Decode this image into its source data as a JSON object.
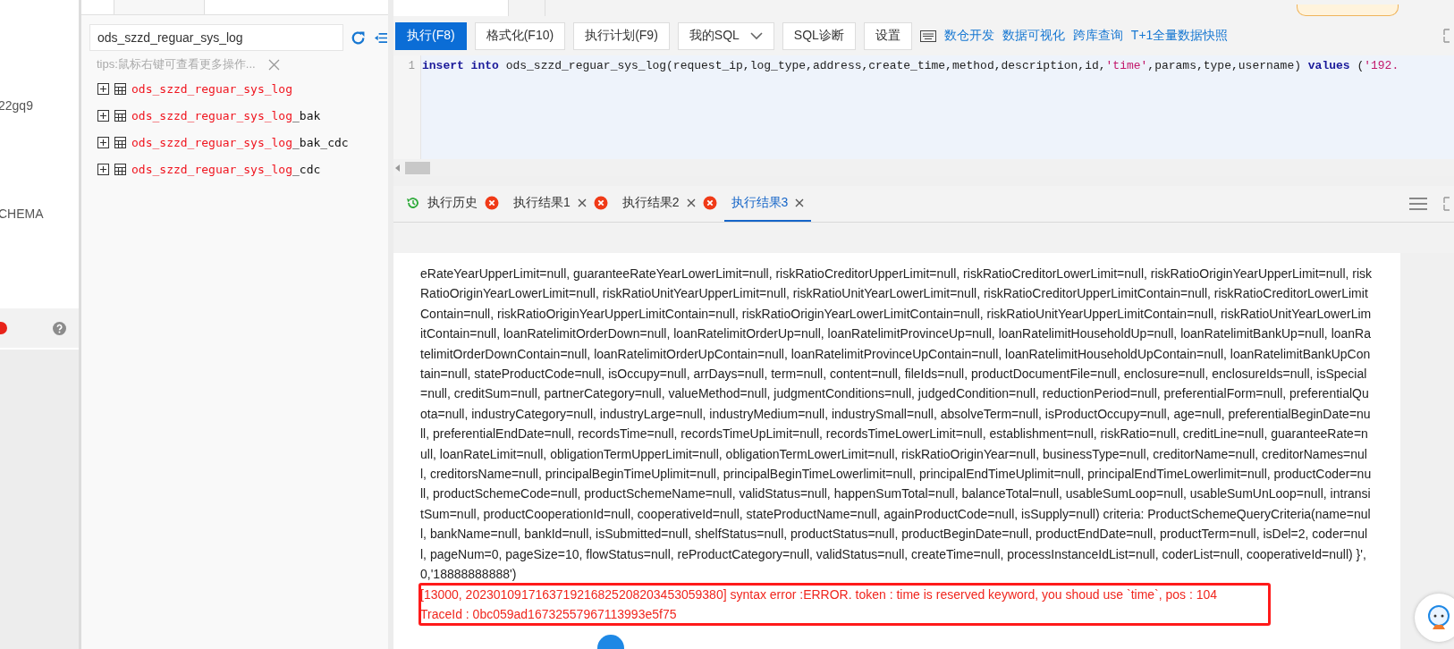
{
  "left_sidebar": {
    "items": [
      {
        "label": "22gq9"
      },
      {
        "label": "CHEMA"
      }
    ]
  },
  "object_panel": {
    "search": {
      "value": "ods_szzd_reguar_sys_log"
    },
    "tips": "tips:鼠标右键可查看更多操作...",
    "tree": [
      {
        "match": "ods_szzd_reguar_sys_log",
        "expanded": false
      },
      {
        "match": "ods_szzd_reguar_sys_log",
        "rest": "_bak",
        "expanded": false
      },
      {
        "match": "ods_szzd_reguar_sys_log",
        "rest": "_bak_cdc",
        "expanded": false
      },
      {
        "match": "ods_szzd_reguar_sys_log",
        "rest": "_cdc",
        "expanded": false
      }
    ]
  },
  "toolbar": {
    "buttons": [
      {
        "label": "执行(F8)",
        "kind": "primary"
      },
      {
        "label": "格式化(F10)",
        "kind": "default"
      },
      {
        "label": "执行计划(F9)",
        "kind": "default"
      },
      {
        "label": "我的SQL",
        "kind": "dropdown"
      },
      {
        "label": "SQL诊断",
        "kind": "default"
      },
      {
        "label": "设置",
        "kind": "default"
      }
    ],
    "links": [
      "数仓开发",
      "数据可视化",
      "跨库查询",
      "T+1全量数据快照"
    ]
  },
  "editor": {
    "line_number": "1",
    "tokens": [
      {
        "kind": "keyword",
        "text": "insert "
      },
      {
        "kind": "keyword",
        "text": "into"
      },
      {
        "kind": "plain",
        "text": " ods_szzd_reguar_sys_log(request_ip,log_type,address,create_time,method,description,id,"
      },
      {
        "kind": "string",
        "text": "'time'"
      },
      {
        "kind": "plain",
        "text": ",params,type,username) "
      },
      {
        "kind": "keyword",
        "text": "values"
      },
      {
        "kind": "plain",
        "text": " ("
      },
      {
        "kind": "string",
        "text": "'192."
      }
    ]
  },
  "result_tabs": [
    {
      "label": "执行历史",
      "kind": "history",
      "selected": false
    },
    {
      "label": "执行结果1",
      "kind": "result",
      "selected": false
    },
    {
      "label": "执行结果2",
      "kind": "result",
      "selected": false
    },
    {
      "label": "执行结果3",
      "kind": "result",
      "selected": true
    }
  ],
  "result": {
    "lines": [
      "eRateYearUpperLimit=null, guaranteeRateYearLowerLimit=null, riskRatioCreditorUpperLimit=null, riskRatioCreditorLowerLimit=null, riskRatioOriginYearUpperLimit=null, risk",
      "RatioOriginYearLowerLimit=null, riskRatioUnitYearUpperLimit=null, riskRatioUnitYearLowerLimit=null, riskRatioCreditorUpperLimitContain=null, riskRatioCreditorLowerLimit",
      "Contain=null, riskRatioOriginYearUpperLimitContain=null, riskRatioOriginYearLowerLimitContain=null, riskRatioUnitYearUpperLimitContain=null, riskRatioUnitYearLowerLim",
      "itContain=null, loanRatelimitOrderDown=null, loanRatelimitOrderUp=null, loanRatelimitProvinceUp=null, loanRatelimitHouseholdUp=null, loanRatelimitBankUp=null, loanRa",
      "telimitOrderDownContain=null, loanRatelimitOrderUpContain=null, loanRatelimitProvinceUpContain=null, loanRatelimitHouseholdUpContain=null, loanRatelimitBankUpCon",
      "tain=null, stateProductCode=null, isOccupy=null, arrDays=null, term=null, content=null, fileIds=null, productDocumentFile=null, enclosure=null, enclosureIds=null, isSpecial",
      "=null, creditSum=null, partnerCategory=null, valueMethod=null, judgmentConditions=null, judgedCondition=null, reductionPeriod=null, preferentialForm=null, preferentialQu",
      "ota=null, industryCategory=null, industryLarge=null, industryMedium=null, industrySmall=null, absolveTerm=null, isProductOccupy=null, age=null, preferentialBeginDate=nu",
      "ll, preferentialEndDate=null, recordsTime=null, recordsTimeUpLimit=null, recordsTimeLowerLimit=null, establishment=null, riskRatio=null, creditLine=null, guaranteeRate=n",
      "ull, loanRateLimit=null, obligationTermUpperLimit=null, obligationTermLowerLimit=null, riskRatioOriginYear=null, businessType=null, creditorName=null, creditorNames=nul",
      "l, creditorsName=null, principalBeginTimeUplimit=null, principalBeginTimeLowerlimit=null, principalEndTimeUplimit=null, principalEndTimeLowerlimit=null, productCoder=nu",
      "ll, productSchemeCode=null, productSchemeName=null, validStatus=null, happenSumTotal=null, balanceTotal=null, usableSumLoop=null, usableSumUnLoop=null, intransi",
      "tSum=null, productCooperationId=null, cooperativeId=null, stateProductName=null, againProductCode=null, isSupply=null) criteria: ProductSchemeQueryCriteria(name=nul",
      "l, bankName=null, bankId=null, isSubmitted=null, shelfStatus=null, productStatus=null, productBeginDate=null, productEndDate=null, productTerm=null, isDel=2, coder=nul",
      "l, pageNum=0, pageSize=10, flowStatus=null, reProductCategory=null, validStatus=null, createTime=null, processInstanceIdList=null, coderList=null, cooperativeId=null) }',",
      "0,'18888888888')"
    ],
    "error_lines": [
      "[13000, 2023010917163719216825208203453059380] syntax error :ERROR. token : time is reserved keyword, you shoud use `time`, pos : 104",
      "TraceId : 0bc059ad16732557967113993e5f75"
    ]
  }
}
